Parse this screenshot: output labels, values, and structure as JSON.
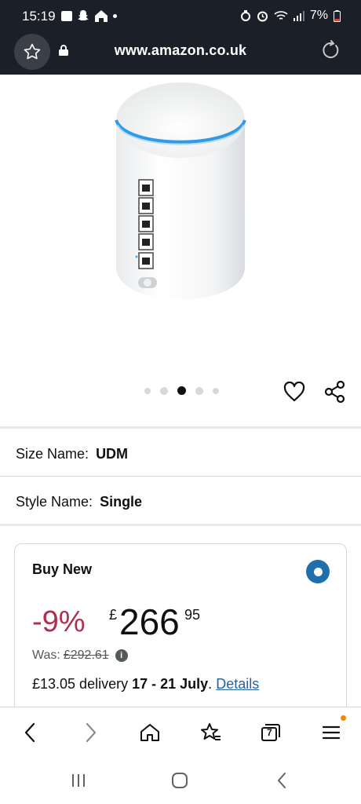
{
  "status_bar": {
    "time": "15:19",
    "battery": "7%"
  },
  "browser": {
    "url": "www.amazon.co.uk"
  },
  "gallery": {
    "dot_count": 5,
    "active_dot": 3
  },
  "variations": {
    "size_label": "Size Name:",
    "size_value": "UDM",
    "style_label": "Style Name:",
    "style_value": "Single"
  },
  "buy_box": {
    "title": "Buy New",
    "discount": "-9%",
    "currency": "£",
    "price_whole": "266",
    "price_fraction": "95",
    "was_label": "Was:",
    "was_price": "£292.61",
    "delivery_cost": "£13.05 delivery",
    "delivery_dates": "17 - 21 July",
    "delivery_period": ".",
    "details_link": "Details"
  },
  "bottom_nav": {
    "tabs_count": "7"
  },
  "colors": {
    "accent_blue": "#1d6fae",
    "discount_red": "#b12e4f",
    "link": "#2162a1",
    "notification": "#f08804"
  }
}
